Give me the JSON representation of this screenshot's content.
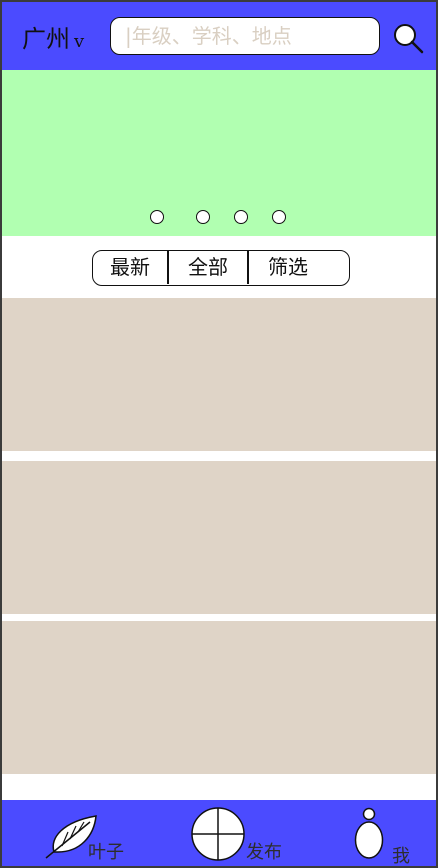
{
  "header": {
    "city": "广州",
    "city_caret": "v",
    "search_placeholder": "|年级、学科、地点"
  },
  "icons": {
    "search": "search-icon",
    "city_dropdown": "chevron-down-icon",
    "home": "leaf-icon",
    "publish": "plus-circle-icon",
    "profile": "person-icon"
  },
  "banner": {
    "slide_count": 4
  },
  "filter_tabs": [
    {
      "label": "最新"
    },
    {
      "label": "全部"
    },
    {
      "label": "筛选"
    }
  ],
  "cards": [
    {
      "label": ""
    },
    {
      "label": ""
    },
    {
      "label": ""
    }
  ],
  "bottom_nav": [
    {
      "label": "叶子"
    },
    {
      "label": "发布"
    },
    {
      "label": "我"
    }
  ],
  "colors": {
    "bar_blue": "#4b4bff",
    "banner_green": "#b1ffb1",
    "card_beige": "#dfd4c7",
    "placeholder_beige": "#d9cfc2"
  }
}
